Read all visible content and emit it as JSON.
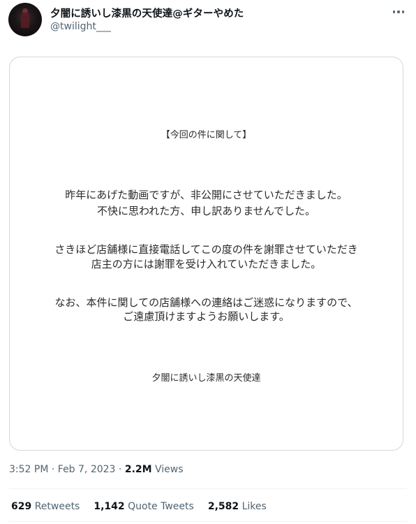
{
  "author": {
    "display_name": "夕闇に誘いし漆黒の天使達@ギターやめた",
    "handle": "@twilight___"
  },
  "notice": {
    "heading": "【今回の件に関して】",
    "paragraph1": [
      "昨年にあげた動画ですが、非公開にさせていただきました。",
      "不快に思われた方、申し訳ありませんでした。"
    ],
    "paragraph2": [
      "さきほど店舗様に直接電話してこの度の件を謝罪させていただき",
      "店主の方には謝罪を受け入れていただきました。"
    ],
    "paragraph3": [
      "なお、本件に関しての店舗様への連絡はご迷惑になりますので、",
      "ご遠慮頂けますようお願いします。"
    ],
    "signature": "夕闇に誘いし漆黒の天使達"
  },
  "meta": {
    "time": "3:52 PM",
    "separator": "·",
    "date": "Feb 7, 2023",
    "views_count": "2.2M",
    "views_label": "Views"
  },
  "stats": {
    "retweets": {
      "count": "629",
      "label": "Retweets"
    },
    "quote_tweets": {
      "count": "1,142",
      "label": "Quote Tweets"
    },
    "likes": {
      "count": "2,582",
      "label": "Likes"
    }
  },
  "icons": {
    "more": "more-horizontal-icon"
  }
}
